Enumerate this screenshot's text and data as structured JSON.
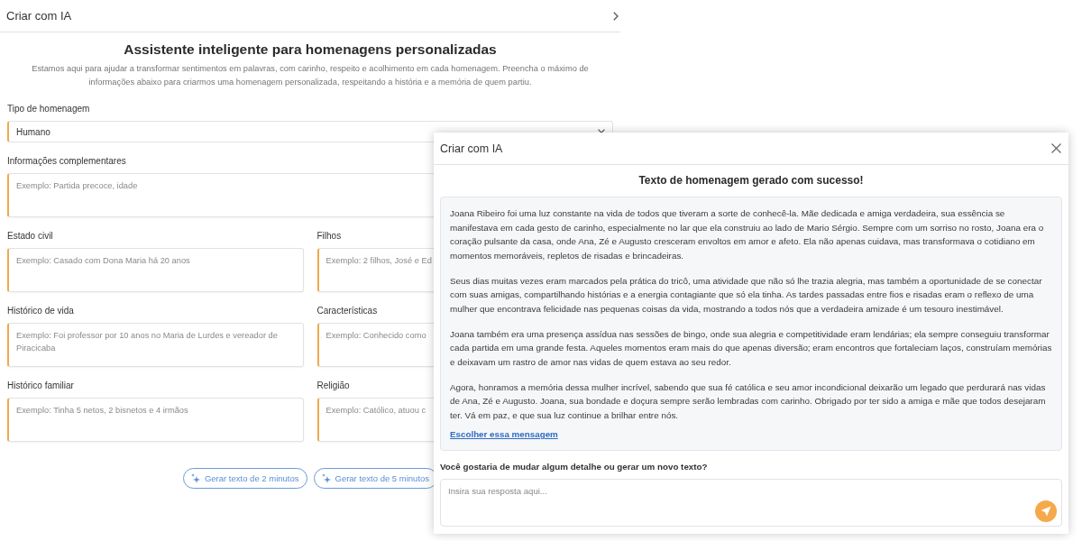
{
  "panel": {
    "title": "Criar com IA",
    "heading": "Assistente inteligente para homenagens personalizadas",
    "intro": "Estamos aqui para ajudar a transformar sentimentos em palavras, com carinho, respeito e acolhimento em cada homenagem. Preencha o máximo de informações abaixo para criarmos uma homenagem personalizada, respeitando a história e a memória de quem partiu.",
    "fields": [
      {
        "kind": "select",
        "label": "Tipo de homenagem",
        "value": "Humano"
      },
      {
        "kind": "textarea",
        "label": "Informações complementares",
        "placeholder": "Exemplo: Partida precoce, idade"
      }
    ],
    "field_grid": [
      {
        "label": "Estado civil",
        "placeholder": "Exemplo: Casado com Dona Maria há 20 anos"
      },
      {
        "label": "Filhos",
        "placeholder": "Exemplo: 2 filhos, José e Ed"
      },
      {
        "label": "Histórico de vida",
        "placeholder": "Exemplo: Foi professor por 10 anos no Maria de Lurdes e vereador de Piracicaba"
      },
      {
        "label": "Características",
        "placeholder": "Exemplo: Conhecido como"
      },
      {
        "label": "Histórico familiar",
        "placeholder": "Exemplo: Tinha 5 netos, 2 bisnetos e 4 irmãos"
      },
      {
        "label": "Religião",
        "placeholder": "Exemplo: Católico, atuou c"
      }
    ],
    "buttons": [
      "Gerar texto de 2 minutos",
      "Gerar texto de 5 minutos"
    ]
  },
  "dialog": {
    "title": "Criar com IA",
    "heading": "Texto de homenagem gerado com sucesso!",
    "paragraphs": [
      "Joana Ribeiro foi uma luz constante na vida de todos que tiveram a sorte de conhecê-la. Mãe dedicada e amiga verdadeira, sua essência se manifestava em cada gesto de carinho, especialmente no lar que ela construiu ao lado de Mario Sérgio. Sempre com um sorriso no rosto, Joana era o coração pulsante da casa, onde Ana, Zé e Augusto cresceram envoltos em amor e afeto. Ela não apenas cuidava, mas transformava o cotidiano em momentos memoráveis, repletos de risadas e brincadeiras.",
      "Seus dias muitas vezes eram marcados pela prática do tricô, uma atividade que não só lhe trazia alegria, mas também a oportunidade de se conectar com suas amigas, compartilhando histórias e a energia contagiante que só ela tinha. As tardes passadas entre fios e risadas eram o reflexo de uma mulher que encontrava felicidade nas pequenas coisas da vida, mostrando a todos nós que a verdadeira amizade é um tesouro inestimável.",
      "Joana também era uma presença assídua nas sessões de bingo, onde sua alegria e competitividade eram lendárias; ela sempre conseguiu transformar cada partida em uma grande festa. Aqueles momentos eram mais do que apenas diversão; eram encontros que fortaleciam laços, construíam memórias e deixavam um rastro de amor nas vidas de quem estava ao seu redor.",
      "Agora, honramos a memória dessa mulher incrível, sabendo que sua fé católica e seu amor incondicional deixarão um legado que perdurará nas vidas de Ana, Zé e Augusto. Joana, sua bondade e doçura sempre serão lembradas com carinho. Obrigado por ter sido a amiga e mãe que todos desejaram ter. Vá em paz, e que sua luz continue a brilhar entre nós."
    ],
    "link": "Escolher essa mensagem",
    "question": "Você gostaria de mudar algum detalhe ou gerar um novo texto?",
    "reply": {
      "placeholder": "Insira sua resposta aqui..."
    }
  }
}
